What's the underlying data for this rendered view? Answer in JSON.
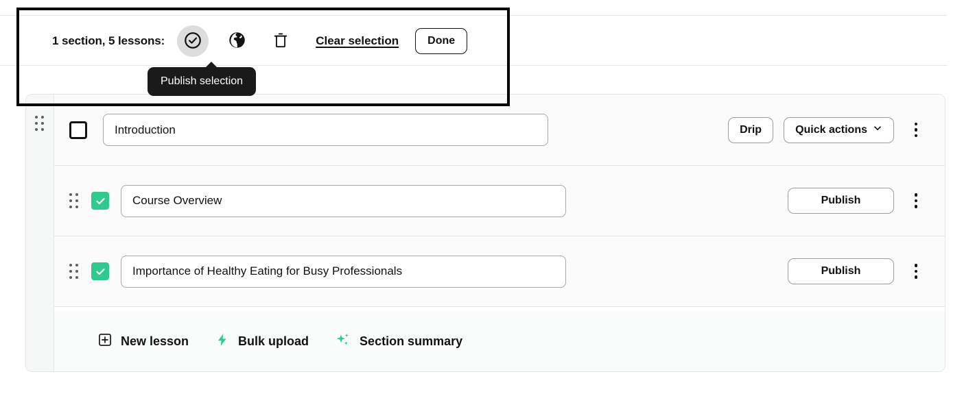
{
  "toolbar": {
    "selection_summary": "1 section, 5 lessons:",
    "publish_icon": "check-circle-icon",
    "globe_icon": "globe-icon",
    "delete_icon": "trash-icon",
    "clear_label": "Clear selection",
    "done_label": "Done"
  },
  "tooltip": {
    "text": "Publish selection"
  },
  "section": {
    "drag_handle_icon": "drag-handle-icon",
    "checked": false,
    "title": "Introduction",
    "title_placeholder": "Section name",
    "drip_label": "Drip",
    "quick_actions_label": "Quick actions",
    "chevron_icon": "chevron-down-icon",
    "overflow_icon": "kebab-menu-icon"
  },
  "lessons": [
    {
      "drag_handle_icon": "drag-handle-icon",
      "checked": true,
      "title": "Course Overview",
      "title_placeholder": "Lesson name",
      "action_label": "Publish",
      "overflow_icon": "kebab-menu-icon"
    },
    {
      "drag_handle_icon": "drag-handle-icon",
      "checked": true,
      "title": "Importance of Healthy Eating for Busy Professionals",
      "title_placeholder": "Lesson name",
      "action_label": "Publish",
      "overflow_icon": "kebab-menu-icon"
    }
  ],
  "footer": {
    "new_lesson_label": "New lesson",
    "new_lesson_icon": "plus-square-icon",
    "bulk_upload_label": "Bulk upload",
    "bulk_upload_icon": "lightning-bolt-icon",
    "section_summary_label": "Section summary",
    "section_summary_icon": "sparkles-icon"
  },
  "colors": {
    "accent_green": "#2fcb8e",
    "text": "#121212",
    "border": "#e4e5e7",
    "tooltip_bg": "#1a1a1a",
    "active_icon_bg": "#dddddd"
  }
}
